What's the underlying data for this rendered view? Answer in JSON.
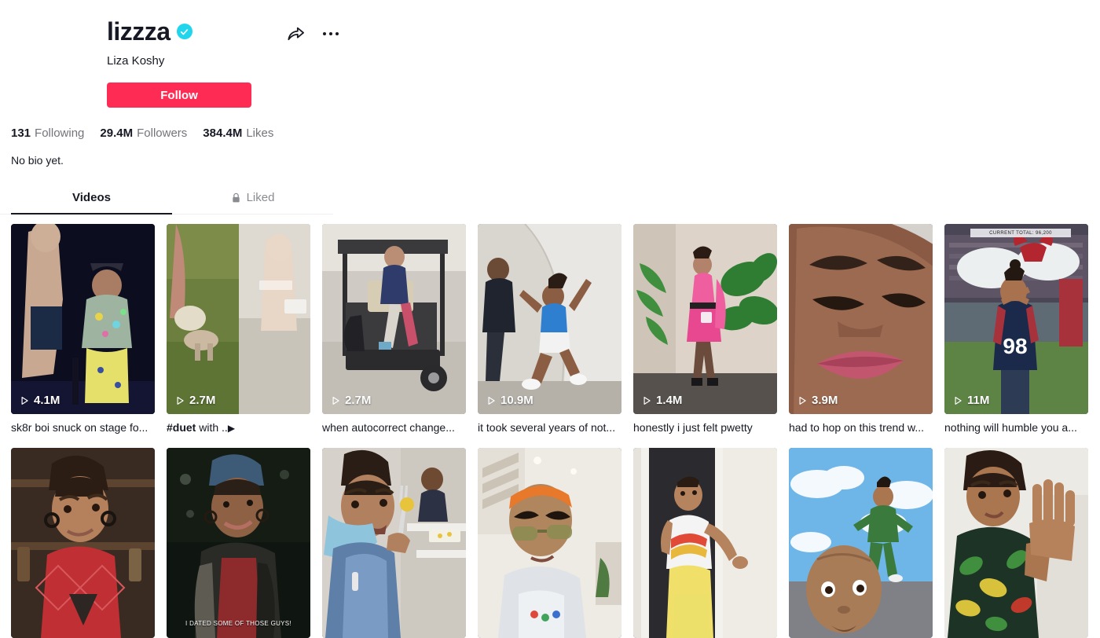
{
  "profile": {
    "username": "lizzza",
    "display_name": "Liza Koshy",
    "verified": true,
    "follow_label": "Follow",
    "bio": "No bio yet.",
    "accent_color": "#FE2C55",
    "verified_color": "#20D5EC",
    "stats": [
      {
        "value": "131",
        "label": "Following"
      },
      {
        "value": "29.4M",
        "label": "Followers"
      },
      {
        "value": "384.4M",
        "label": "Likes"
      }
    ],
    "actions": [
      {
        "name": "share-icon",
        "label": "Share"
      },
      {
        "name": "more-icon",
        "label": "More"
      }
    ]
  },
  "tabs": [
    {
      "label": "Videos",
      "active": true,
      "locked": false
    },
    {
      "label": "Liked",
      "active": false,
      "locked": true
    }
  ],
  "videos": [
    {
      "plays": "4.1M",
      "caption": "sk8r boi snuck on stage fo...",
      "caption_tag": ""
    },
    {
      "plays": "2.7M",
      "caption": " with ..",
      "caption_tag": "#duet",
      "caption_suffix_icon": "play-glyph"
    },
    {
      "plays": "2.7M",
      "caption": "when autocorrect change...",
      "caption_tag": ""
    },
    {
      "plays": "10.9M",
      "caption": "it took several years of not...",
      "caption_tag": ""
    },
    {
      "plays": "1.4M",
      "caption": "honestly i just felt pwetty",
      "caption_tag": ""
    },
    {
      "plays": "3.9M",
      "caption": "had to hop on this trend w...",
      "caption_tag": ""
    },
    {
      "plays": "11M",
      "caption": "nothing will humble you a...",
      "caption_tag": ""
    }
  ],
  "videos_row2": [
    {
      "overlay_text": ""
    },
    {
      "overlay_text": "I DATED SOME OF THOSE GUYS!"
    },
    {
      "overlay_text": ""
    },
    {
      "overlay_text": ""
    },
    {
      "overlay_text": ""
    },
    {
      "overlay_text": ""
    },
    {
      "overlay_text": ""
    }
  ],
  "scoreboard_text": "CURRENT TOTAL: 96,200"
}
